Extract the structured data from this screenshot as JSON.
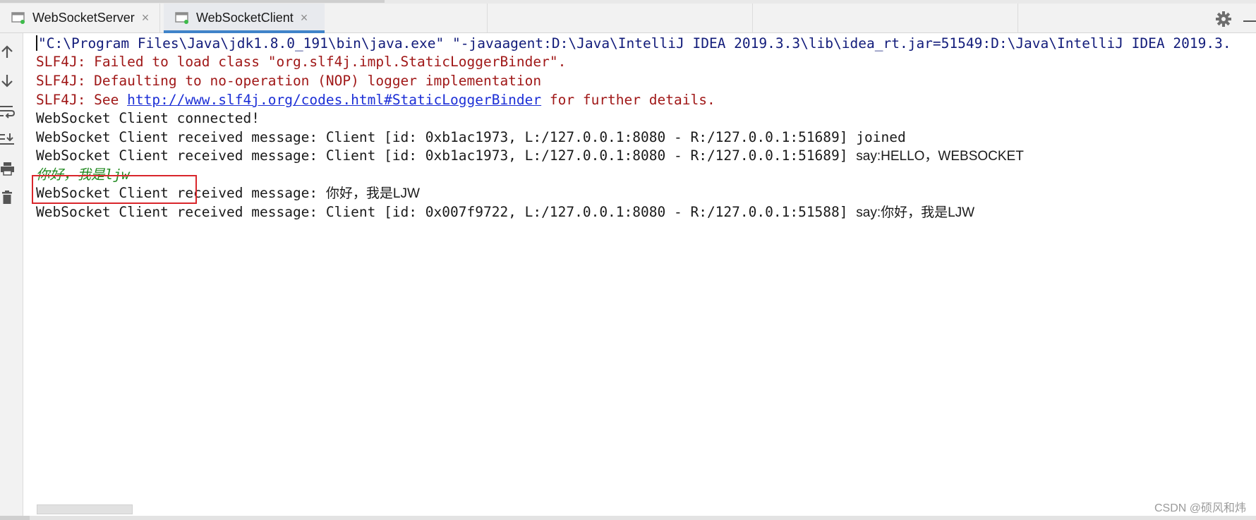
{
  "tabs": [
    {
      "label": "WebSocketServer",
      "close": "×",
      "active": false
    },
    {
      "label": "WebSocketClient",
      "close": "×",
      "active": true
    }
  ],
  "colors": {
    "command": "#111b7a",
    "error": "#a01818",
    "output": "#1a1a1a",
    "user_input": "#218a21",
    "link": "#1c2fd6",
    "active_tab_indicator": "#4083c9",
    "highlight_box": "#d9262b"
  },
  "sidebar_icons": [
    "arrow-up-icon",
    "arrow-down-icon",
    "soft-wrap-icon",
    "scroll-to-end-icon",
    "print-icon",
    "trash-icon"
  ],
  "console": {
    "line1": "\"C:\\Program Files\\Java\\jdk1.8.0_191\\bin\\java.exe\" \"-javaagent:D:\\Java\\IntelliJ IDEA 2019.3.3\\lib\\idea_rt.jar=51549:D:\\Java\\IntelliJ IDEA 2019.3.",
    "line2": "SLF4J: Failed to load class \"org.slf4j.impl.StaticLoggerBinder\".",
    "line3": "SLF4J: Defaulting to no-operation (NOP) logger implementation",
    "line4_prefix": "SLF4J: See ",
    "line4_link": "http://www.slf4j.org/codes.html#StaticLoggerBinder",
    "line4_suffix": " for further details.",
    "line5": "WebSocket Client connected!",
    "line6": "WebSocket Client received message: Client [id: 0xb1ac1973, L:/127.0.0.1:8080 - R:/127.0.0.1:51689] joined",
    "line7_mono": "WebSocket Client received message: Client [id: 0xb1ac1973, L:/127.0.0.1:8080 - R:/127.0.0.1:51689] ",
    "line7_sans": "say:HELLO，WEBSOCKET",
    "line8": "你好，我是ljw",
    "line9_mono": "WebSocket Client received message: ",
    "line9_sans": "你好，我是LJW",
    "line10_mono": "WebSocket Client received message: Client [id: 0x007f9722, L:/127.0.0.1:8080 - R:/127.0.0.1:51588] ",
    "line10_sans": "say:你好，我是LJW"
  },
  "watermark": "CSDN @硕风和炜"
}
